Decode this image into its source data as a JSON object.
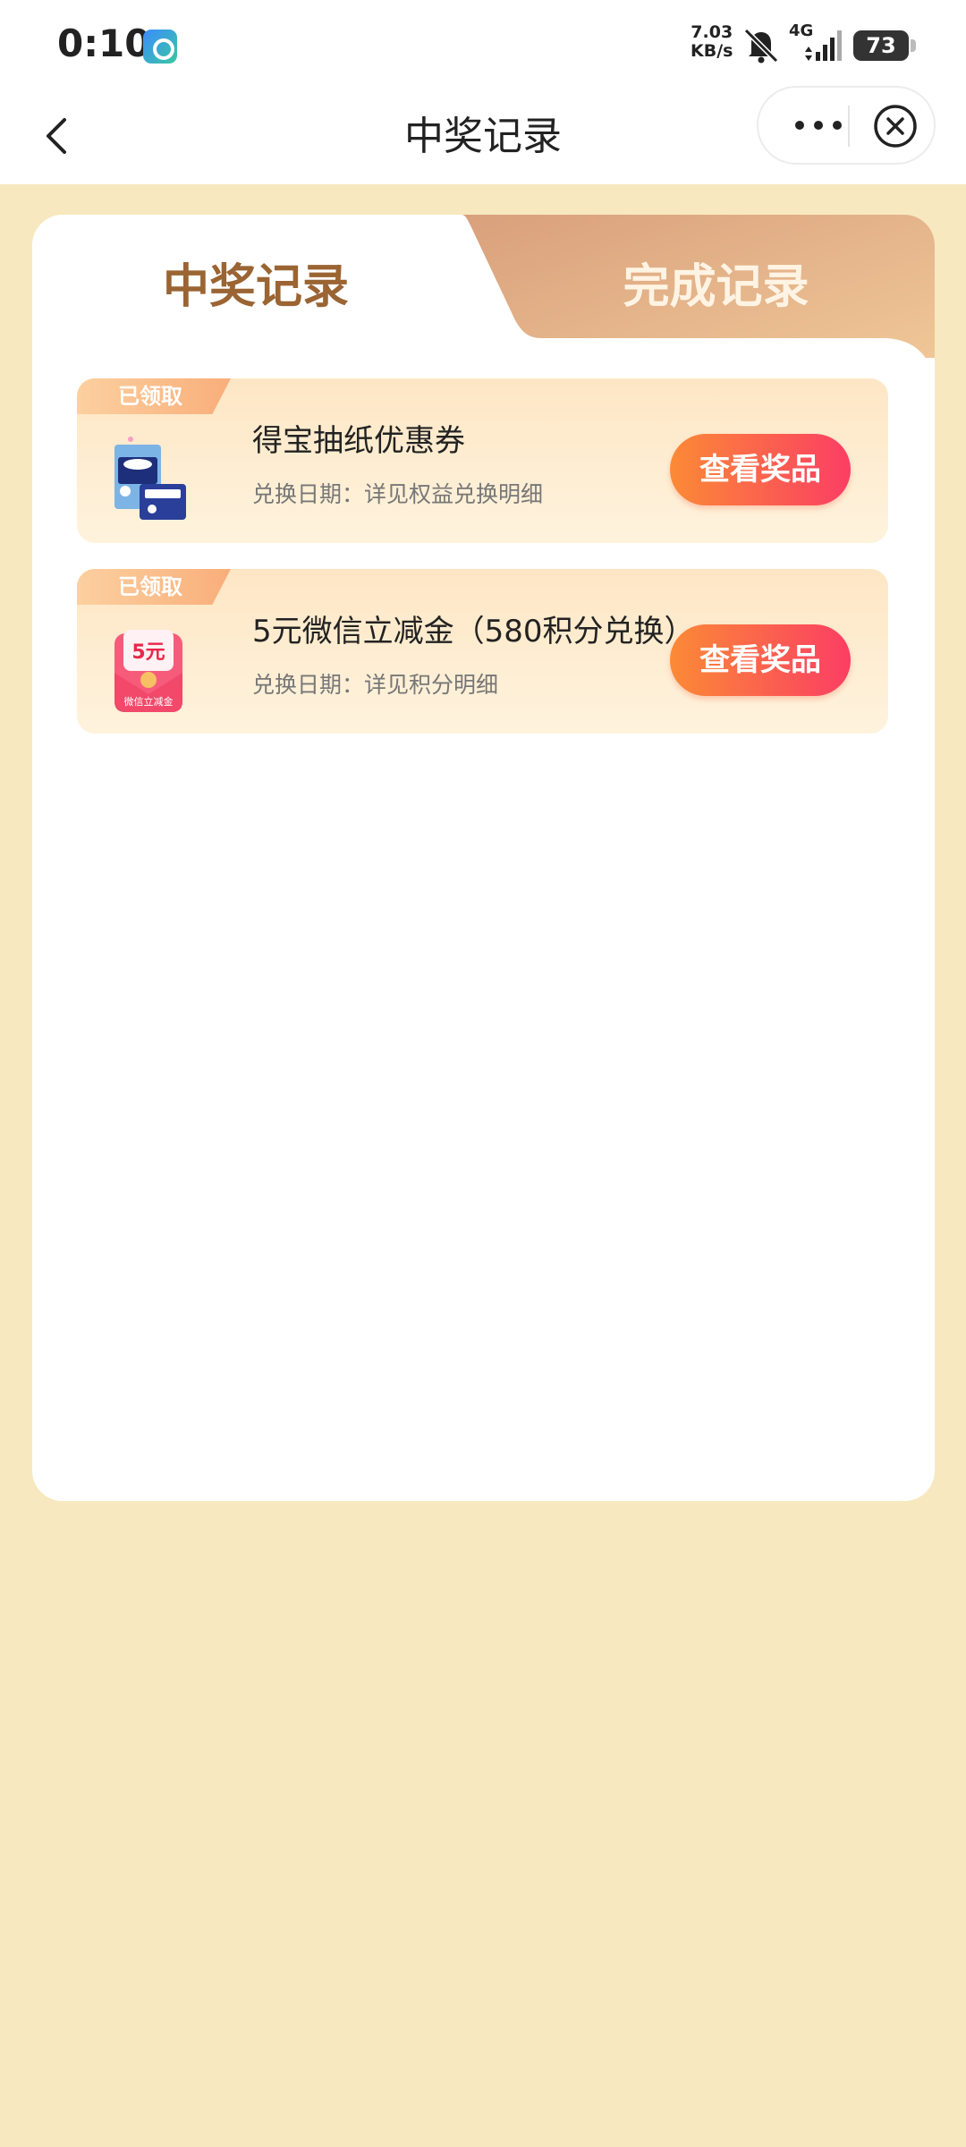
{
  "status_bar": {
    "time": "0:10",
    "net_speed_value": "7.03",
    "net_speed_unit": "KB/s",
    "network_type": "4G",
    "battery": "73"
  },
  "nav": {
    "title": "中奖记录"
  },
  "tabs": {
    "active": "中奖记录",
    "inactive": "完成记录"
  },
  "records": [
    {
      "tag": "已领取",
      "title": "得宝抽纸优惠券",
      "date": "兑换日期：详见权益兑换明细",
      "button": "查看奖品",
      "thumb_icon": "tissue-pack-icon"
    },
    {
      "tag": "已领取",
      "title": "5元微信立减金（580积分兑换）",
      "date": "兑换日期：详见积分明细",
      "button": "查看奖品",
      "thumb_icon": "red-envelope-icon",
      "thumb_value": "5元",
      "thumb_caption": "微信立减金"
    }
  ],
  "colors": {
    "page_bg": "#f7e8bf",
    "active_tab_text": "#9a6433",
    "button_gradient_start": "#fb8a36",
    "button_gradient_end": "#fb3e64"
  }
}
